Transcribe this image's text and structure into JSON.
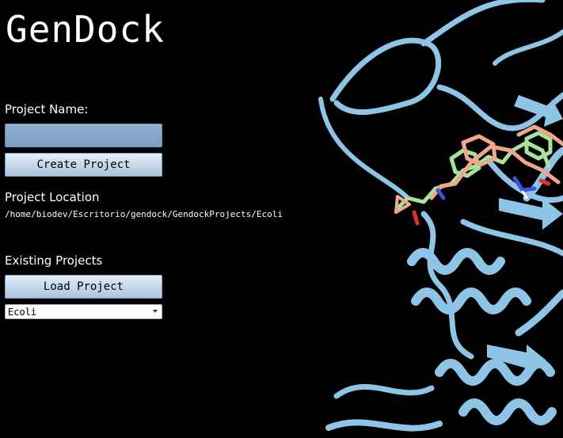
{
  "app": {
    "title": "GenDock"
  },
  "project": {
    "name_label": "Project Name:",
    "name_value": "",
    "create_button": "Create Project",
    "location_label": "Project Location",
    "location_path": "/home/biodev/Escritorio/gendock/GendockProjects/Ecoli"
  },
  "existing": {
    "label": "Existing Projects",
    "load_button": "Load Project",
    "selected": "Ecoli"
  },
  "colors": {
    "background": "#000000",
    "protein": "#8ec5e6",
    "ligand_a": "#f0a58e",
    "ligand_b": "#a6e39a"
  },
  "image": {
    "subject": "protein-ligand-docking-render"
  }
}
